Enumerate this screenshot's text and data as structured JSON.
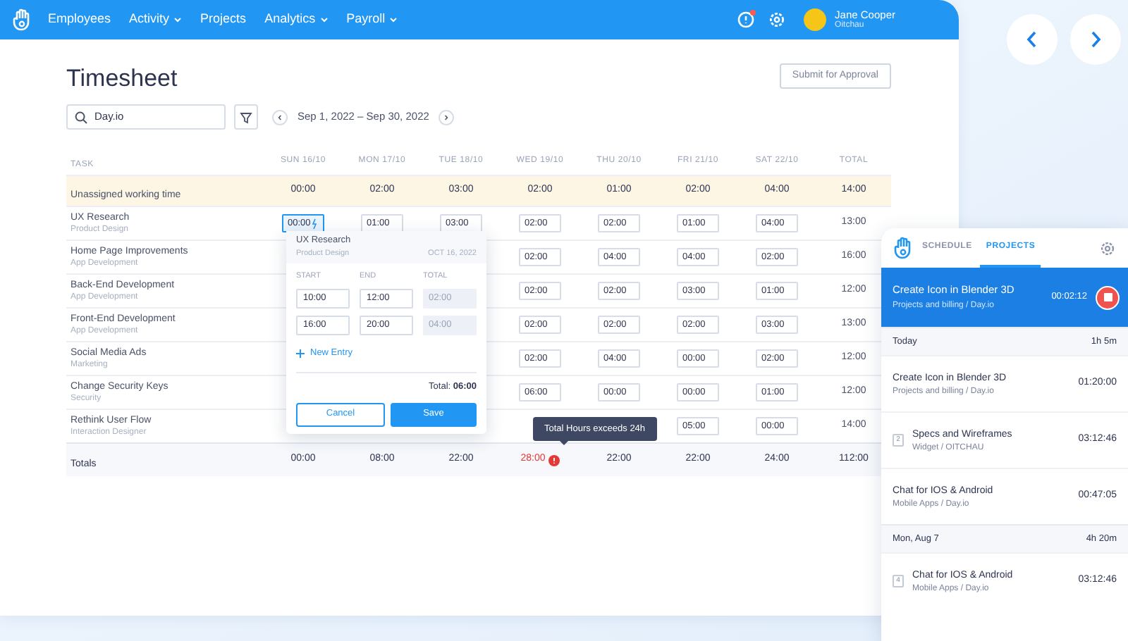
{
  "nav": {
    "items": [
      {
        "label": "Employees",
        "has_menu": false
      },
      {
        "label": "Activity",
        "has_menu": true
      },
      {
        "label": "Projects",
        "has_menu": false
      },
      {
        "label": "Analytics",
        "has_menu": true
      },
      {
        "label": "Payroll",
        "has_menu": true
      }
    ],
    "notification": true,
    "user": {
      "name": "Jane Cooper",
      "company": "Oitchau"
    }
  },
  "page": {
    "title": "Timesheet",
    "submit_button": "Submit for Approval",
    "search": {
      "value": "Day.io"
    },
    "date_range": "Sep 1, 2022 – Sep 30, 2022"
  },
  "table": {
    "task_header": "TASK",
    "day_headers": [
      "SUN 16/10",
      "MON 17/10",
      "TUE 18/10",
      "WED 19/10",
      "THU 20/10",
      "FRI 21/10",
      "SAT 22/10"
    ],
    "total_header": "TOTAL",
    "rows": [
      {
        "kind": "unassigned",
        "task": "Unassigned working time",
        "hours": {
          "sun": "00:00",
          "mon": "02:00",
          "tue": "03:00",
          "wed": "02:00",
          "thu": "01:00",
          "fri": "02:00",
          "sat": "04:00"
        },
        "total": "14:00"
      },
      {
        "kind": "task",
        "task": "UX Research",
        "category": "Product Design",
        "editing": true,
        "hours": {
          "sun": "00:00",
          "mon": "01:00",
          "tue": "03:00",
          "wed": "02:00",
          "thu": "02:00",
          "fri": "01:00",
          "sat": "04:00"
        },
        "total": "13:00"
      },
      {
        "kind": "task",
        "task": "Home Page Improvements",
        "category": "App Development",
        "hours": {
          "wed": "02:00",
          "thu": "04:00",
          "fri": "04:00",
          "sat": "02:00"
        },
        "total": "16:00"
      },
      {
        "kind": "task",
        "task": "Back-End Development",
        "category": "App Development",
        "hours": {
          "wed": "02:00",
          "thu": "02:00",
          "fri": "03:00",
          "sat": "01:00"
        },
        "total": "12:00"
      },
      {
        "kind": "task",
        "task": "Front-End Development",
        "category": "App Development",
        "hours": {
          "wed": "02:00",
          "thu": "02:00",
          "fri": "02:00",
          "sat": "03:00"
        },
        "total": "13:00"
      },
      {
        "kind": "task",
        "task": "Social Media Ads",
        "category": "Marketing",
        "hours": {
          "wed": "02:00",
          "thu": "04:00",
          "fri": "00:00",
          "sat": "02:00"
        },
        "total": "12:00"
      },
      {
        "kind": "task",
        "task": "Change Security Keys",
        "category": "Security",
        "hours": {
          "wed": "06:00",
          "thu": "00:00",
          "fri": "00:00",
          "sat": "01:00"
        },
        "total": "12:00"
      },
      {
        "kind": "task",
        "task": "Rethink User Flow",
        "category": "Interaction Designer",
        "hours": {
          "fri": "05:00",
          "sat": "00:00"
        },
        "total": "14:00"
      }
    ],
    "totals": {
      "label": "Totals",
      "values": [
        {
          "value": "00:00",
          "over_limit": false
        },
        {
          "value": "08:00",
          "over_limit": false
        },
        {
          "value": "22:00",
          "over_limit": false
        },
        {
          "value": "28:00",
          "over_limit": true
        },
        {
          "value": "22:00",
          "over_limit": false
        },
        {
          "value": "22:00",
          "over_limit": false
        },
        {
          "value": "24:00",
          "over_limit": false
        },
        {
          "value": "112:00",
          "over_limit": false
        }
      ]
    }
  },
  "popup": {
    "task": "UX Research",
    "category": "Product Design",
    "date": "OCT 16, 2022",
    "headers": [
      "START",
      "END",
      "TOTAL"
    ],
    "entries": [
      {
        "start": "10:00",
        "end": "12:00",
        "total": "02:00"
      },
      {
        "start": "16:00",
        "end": "20:00",
        "total": "04:00"
      }
    ],
    "new_entry": "New Entry",
    "total": "Total: **06:00**",
    "cancel": "Cancel",
    "save": "Save"
  },
  "tooltip": "Total Hours exceeds 24h",
  "panel": {
    "tabs": [
      {
        "label": "SCHEDULE",
        "selected": false
      },
      {
        "label": "PROJECTS",
        "selected": true
      }
    ],
    "running": {
      "title": "Create Icon in Blender 3D",
      "project": "Projects and billing / Day.io",
      "time": "00:02:12"
    },
    "groups": [
      {
        "label": "Today",
        "total": "1h 5m",
        "entries": [
          {
            "title": "Create Icon in Blender 3D",
            "project": "Projects and billing / Day.io",
            "time": "01:20:00"
          },
          {
            "title": "Specs and Wireframes",
            "project": "Widget / OITCHAU",
            "time": "03:12:46",
            "count": "2"
          },
          {
            "title": "Chat for IOS & Android",
            "project": "Mobile Apps / Day.io",
            "time": "00:47:05"
          }
        ]
      },
      {
        "label": "Mon, Aug 7",
        "total": "4h 20m",
        "entries": [
          {
            "title": "Chat for IOS & Android",
            "project": "Mobile Apps / Day.io",
            "time": "03:12:46",
            "count": "4"
          }
        ]
      }
    ]
  }
}
